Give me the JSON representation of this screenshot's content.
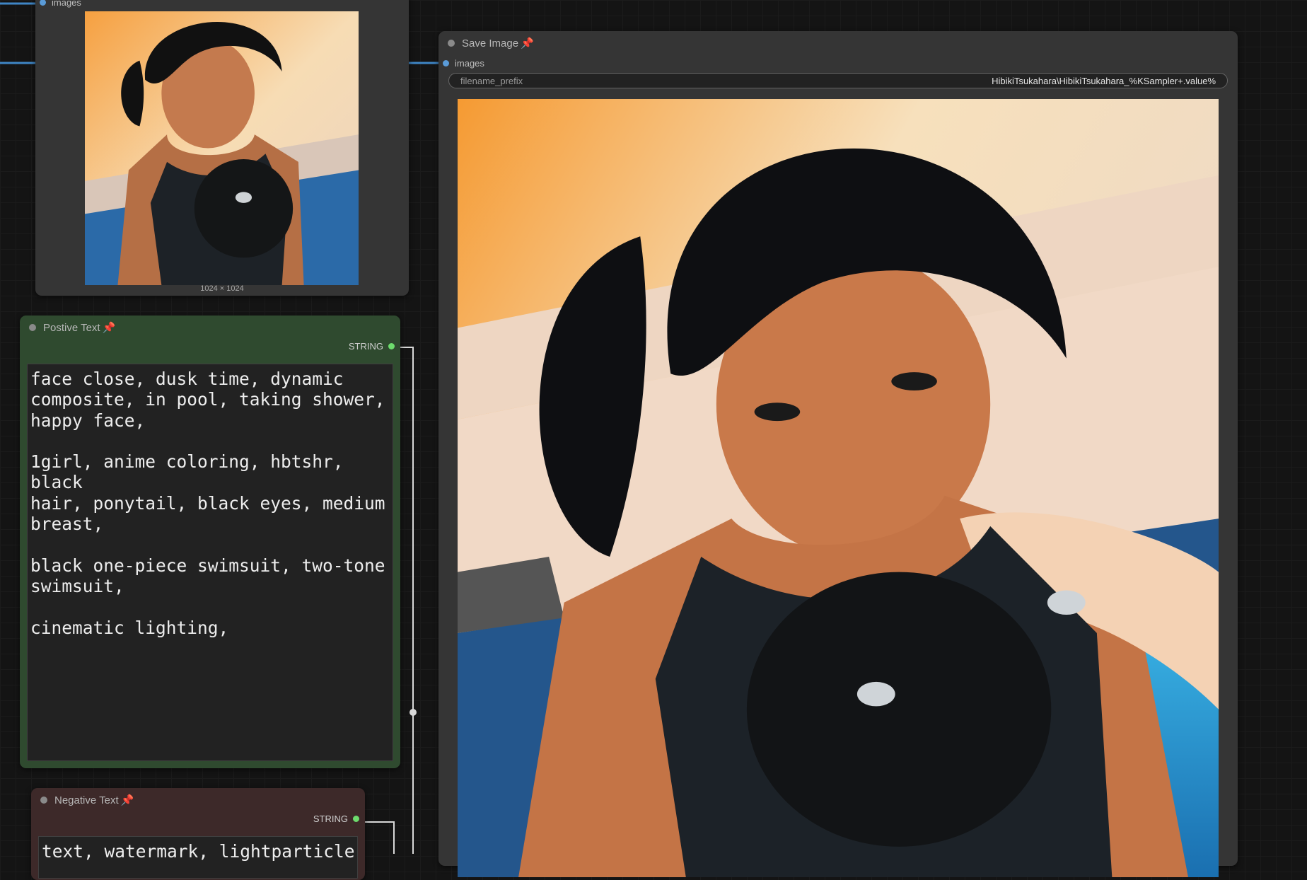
{
  "preview_node": {
    "input_label": "images",
    "size_label": "1024 × 1024"
  },
  "save_node": {
    "title": "Save Image",
    "input_label": "images",
    "widget": {
      "label": "filename_prefix",
      "value": "HibikiTsukahara\\HibikiTsukahara_%KSampler+.value%"
    }
  },
  "positive_node": {
    "title": "Postive Text",
    "output_label": "STRING",
    "text": "face close, dusk time, dynamic\ncomposite, in pool, taking shower,\nhappy face,\n\n1girl, anime coloring, hbtshr, black\nhair, ponytail, black eyes, medium\nbreast,\n\nblack one-piece swimsuit, two-tone\nswimsuit,\n\ncinematic lighting,"
  },
  "negative_node": {
    "title": "Negative Text",
    "output_label": "STRING",
    "text": "text, watermark, lightparticle,"
  },
  "colors": {
    "image_socket": "#5a9bd8",
    "string_socket": "#6ddc6d",
    "positive_node_bg": "#2f4a2f",
    "negative_node_bg": "#3d2929",
    "pin": "#e0304f",
    "wire_images": "#3f86c6",
    "wire_string": "#d8d8d8"
  }
}
